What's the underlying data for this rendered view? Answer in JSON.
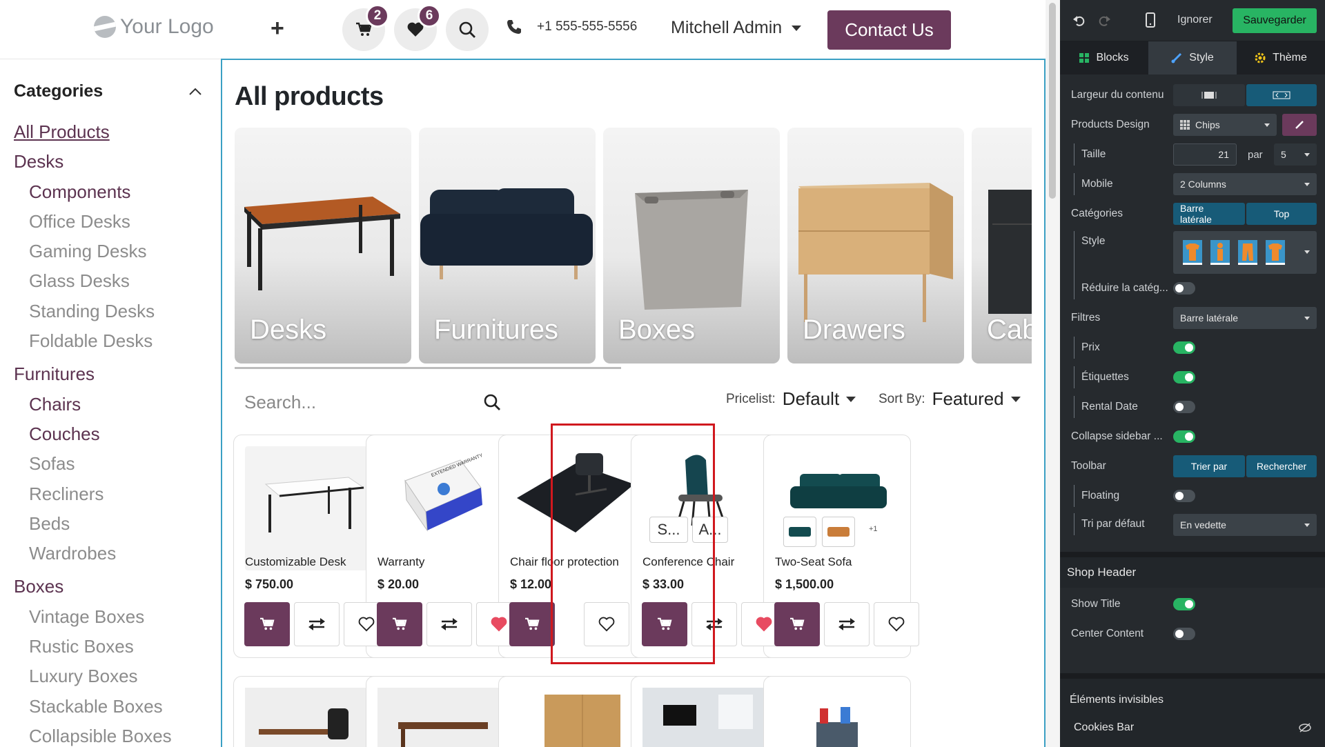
{
  "header": {
    "logo_text": "Your Logo",
    "cart_count": "2",
    "wishlist_count": "6",
    "phone": "+1 555-555-5556",
    "user": "Mitchell Admin",
    "contact_label": "Contact Us"
  },
  "sidebar": {
    "title": "Categories",
    "items": [
      {
        "label": "All Products",
        "level": "all"
      },
      {
        "label": "Desks",
        "level": "top"
      },
      {
        "label": "Components",
        "level": "sub-active"
      },
      {
        "label": "Office Desks",
        "level": "sub"
      },
      {
        "label": "Gaming Desks",
        "level": "sub"
      },
      {
        "label": "Glass Desks",
        "level": "sub"
      },
      {
        "label": "Standing Desks",
        "level": "sub"
      },
      {
        "label": "Foldable Desks",
        "level": "sub"
      },
      {
        "label": "Furnitures",
        "level": "top"
      },
      {
        "label": "Chairs",
        "level": "sub-active"
      },
      {
        "label": "Couches",
        "level": "sub-active"
      },
      {
        "label": "Sofas",
        "level": "sub"
      },
      {
        "label": "Recliners",
        "level": "sub"
      },
      {
        "label": "Beds",
        "level": "sub"
      },
      {
        "label": "Wardrobes",
        "level": "sub"
      },
      {
        "label": "Boxes",
        "level": "top"
      },
      {
        "label": "Vintage Boxes",
        "level": "sub"
      },
      {
        "label": "Rustic Boxes",
        "level": "sub"
      },
      {
        "label": "Luxury Boxes",
        "level": "sub"
      },
      {
        "label": "Stackable Boxes",
        "level": "sub"
      },
      {
        "label": "Collapsible Boxes",
        "level": "sub"
      }
    ]
  },
  "main": {
    "title": "All products",
    "carousel": [
      "Desks",
      "Furnitures",
      "Boxes",
      "Drawers",
      "Cab"
    ],
    "search_placeholder": "Search...",
    "pricelist_label": "Pricelist:",
    "pricelist_value": "Default",
    "sort_label": "Sort By:",
    "sort_value": "Featured",
    "products": [
      {
        "name": "Customizable Desk",
        "price": "$ 750.00",
        "wish_active": false
      },
      {
        "name": "Warranty",
        "price": "$ 20.00",
        "wish_active": true
      },
      {
        "name": "Chair floor protection",
        "price": "$ 12.00",
        "wish_active": false
      },
      {
        "name": "Conference Chair",
        "price": "$ 33.00",
        "wish_active": true
      },
      {
        "name": "Two-Seat Sofa",
        "price": "$ 1,500.00",
        "wish_active": false
      }
    ],
    "chair_pills": [
      "S...",
      "A..."
    ],
    "sofa_more": "+1",
    "warranty_box_text": "EXTENDED WARRANTY"
  },
  "editor": {
    "ignore_label": "Ignorer",
    "save_label": "Sauvegarder",
    "tabs": [
      "Blocks",
      "Style",
      "Thème"
    ],
    "options": {
      "content_width": "Largeur du contenu",
      "products_design": "Products Design",
      "design_value": "Chips",
      "size": "Taille",
      "size_value": "21",
      "par": "par",
      "per_row": "5",
      "mobile": "Mobile",
      "mobile_value": "2 Columns",
      "categories": "Catégories",
      "cat_sidebar": "Barre latérale",
      "cat_top": "Top",
      "style": "Style",
      "reduce": "Réduire la catég...",
      "filters": "Filtres",
      "filters_value": "Barre latérale",
      "price": "Prix",
      "tags": "Étiquettes",
      "rental": "Rental Date",
      "collapse": "Collapse sidebar ...",
      "toolbar": "Toolbar",
      "sort_by": "Trier par",
      "search": "Rechercher",
      "floating": "Floating",
      "default_sort": "Tri par défaut",
      "default_sort_value": "En vedette"
    },
    "shop_header": "Shop Header",
    "show_title": "Show Title",
    "center_content": "Center Content",
    "invisible": "Éléments invisibles",
    "cookies": "Cookies Bar"
  },
  "colors": {
    "accent": "#6b3a5c",
    "selection": "#3aa0c4",
    "highlight": "#d0181e",
    "toggle_on": "#28b463"
  }
}
